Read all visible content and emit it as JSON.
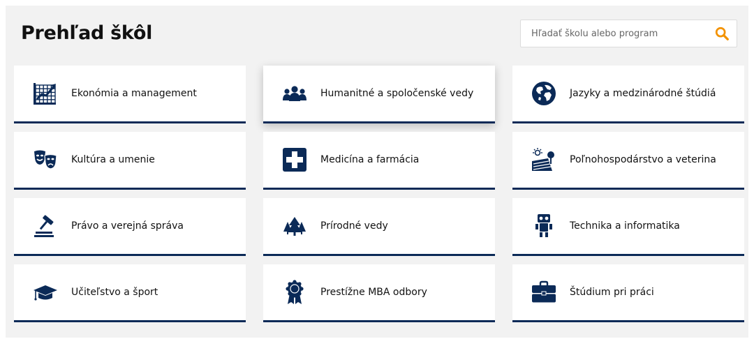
{
  "page": {
    "title": "Prehľad škôl"
  },
  "search": {
    "placeholder": "Hľadať školu alebo program",
    "icon": "magnifier-icon",
    "accent": "#f39200"
  },
  "colors": {
    "navy": "#0b2a57",
    "background": "#f2f2f2"
  },
  "categories": [
    {
      "label": "Ekonómia a management",
      "icon": "chart-icon"
    },
    {
      "label": "Humanitné a spoločenské vedy",
      "icon": "people-group-icon"
    },
    {
      "label": "Jazyky a medzinárodné štúdiá",
      "icon": "globe-icon"
    },
    {
      "label": "Kultúra a umenie",
      "icon": "theater-masks-icon"
    },
    {
      "label": "Medicína a farmácia",
      "icon": "medical-cross-icon"
    },
    {
      "label": "Poľnohospodárstvo a veterina",
      "icon": "farm-field-icon"
    },
    {
      "label": "Právo a verejná správa",
      "icon": "gavel-icon"
    },
    {
      "label": "Prírodné vedy",
      "icon": "trees-icon"
    },
    {
      "label": "Technika a informatika",
      "icon": "robot-icon"
    },
    {
      "label": "Učiteľstvo a šport",
      "icon": "graduation-cap-icon"
    },
    {
      "label": "Prestížne MBA odbory",
      "icon": "award-badge-icon"
    },
    {
      "label": "Štúdium pri práci",
      "icon": "briefcase-icon"
    }
  ]
}
